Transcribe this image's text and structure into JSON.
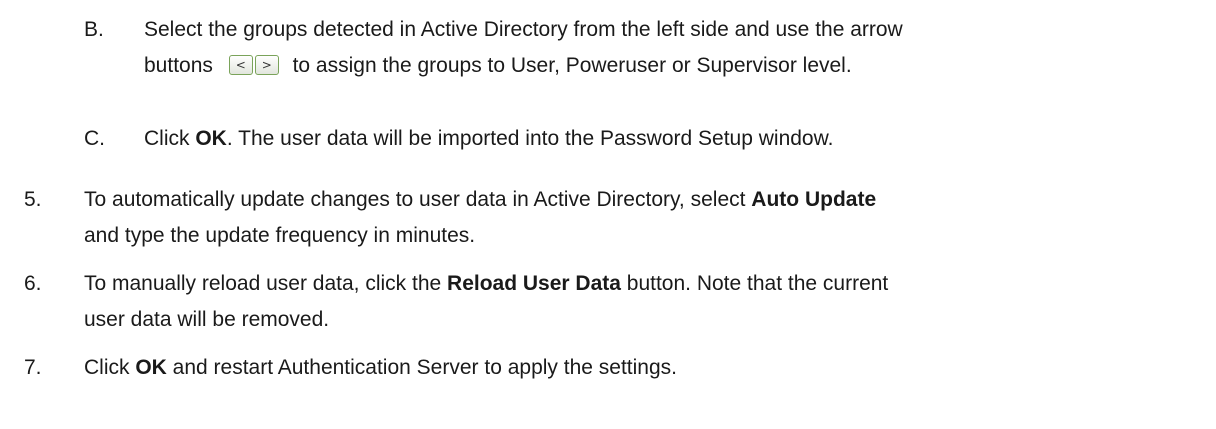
{
  "steps": {
    "b": {
      "label": "B.",
      "line1": "Select the groups detected in Active Directory from the left side and use the arrow",
      "line2_before": "buttons",
      "line2_after": "to assign the groups to User, Poweruser or Supervisor level.",
      "left_arrow": "<",
      "right_arrow": ">"
    },
    "c": {
      "label": "C.",
      "pre": "Click ",
      "bold": "OK",
      "post": ". The user data will be imported into the Password Setup window."
    },
    "s5": {
      "label": "5.",
      "pre": "To automatically update changes to user data in Active Directory, select ",
      "bold": "Auto Update",
      "line2": "and type the update frequency in minutes."
    },
    "s6": {
      "label": "6.",
      "pre": "To manually reload user data, click the ",
      "bold": "Reload User Data",
      "post": " button. Note that the current",
      "line2": "user data will be removed."
    },
    "s7": {
      "label": "7.",
      "pre": "Click ",
      "bold": "OK",
      "post": " and restart Authentication Server to apply the settings."
    }
  }
}
